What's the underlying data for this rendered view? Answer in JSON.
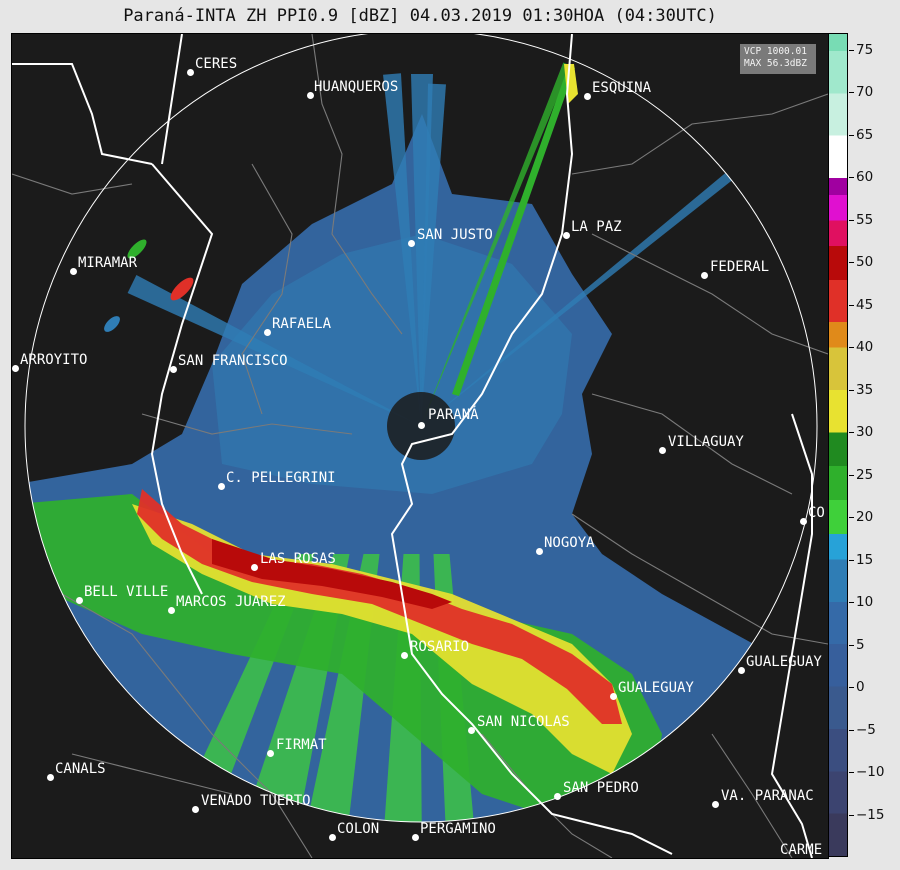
{
  "title": "Paraná-INTA ZH PPI0.9 [dBZ] 04.03.2019 01:30HOA (04:30UTC)",
  "info_box": {
    "line1": "VCP 1000.01",
    "line2": "MAX 56.3dBZ"
  },
  "colorbar": {
    "ticks": [
      "75",
      "70",
      "65",
      "60",
      "55",
      "50",
      "45",
      "40",
      "35",
      "30",
      "25",
      "20",
      "15",
      "10",
      "5",
      "0",
      "−5",
      "−10",
      "−15"
    ],
    "colors": {
      "c_-20": "#3a3a5c",
      "c_-15": "#3c4470",
      "c_-10": "#3b4e80",
      "c_-5": "#3a5a8e",
      "c_0": "#375f9c",
      "c_5": "#356aa8",
      "c_10": "#2f7db5",
      "c_15": "#27a2d8",
      "c_18": "#3fd03a",
      "c_22": "#2fb02c",
      "c_26": "#208a20",
      "c_30": "#e8e230",
      "c_35": "#d8c43a",
      "c_40": "#e08a1a",
      "c_43": "#e03028",
      "c_48": "#b80a0a",
      "c_52": "#e01060",
      "c_55": "#e010d0",
      "c_58": "#a000a0",
      "c_60": "#ffffff",
      "c_65": "#c8f0e0",
      "c_70": "#a0e8cc",
      "c_75": "#78dcb4"
    }
  },
  "cities": [
    {
      "name": "CERES"
    },
    {
      "name": "HUANQUEROS"
    },
    {
      "name": "ESQUINA"
    },
    {
      "name": "SAN JUSTO"
    },
    {
      "name": "LA PAZ"
    },
    {
      "name": "MIRAMAR"
    },
    {
      "name": "FEDERAL"
    },
    {
      "name": "RAFAELA"
    },
    {
      "name": "ARROYITO"
    },
    {
      "name": "SAN FRANCISCO"
    },
    {
      "name": "PARANÁ"
    },
    {
      "name": "VILLAGUAY"
    },
    {
      "name": "C. PELLEGRINI"
    },
    {
      "name": "CO"
    },
    {
      "name": "NOGOYA"
    },
    {
      "name": "LAS ROSAS"
    },
    {
      "name": "BELL VILLE"
    },
    {
      "name": "MARCOS JUAREZ"
    },
    {
      "name": "ROSARIO"
    },
    {
      "name": "GUALEGUAY"
    },
    {
      "name": "GUALEGUAY"
    },
    {
      "name": "SAN NICOLAS"
    },
    {
      "name": "FIRMAT"
    },
    {
      "name": "CANALS"
    },
    {
      "name": "SAN PEDRO"
    },
    {
      "name": "VENADO TUERTO"
    },
    {
      "name": "VA. PARANAC"
    },
    {
      "name": "COLON"
    },
    {
      "name": "PERGAMINO"
    },
    {
      "name": "CARME"
    }
  ]
}
